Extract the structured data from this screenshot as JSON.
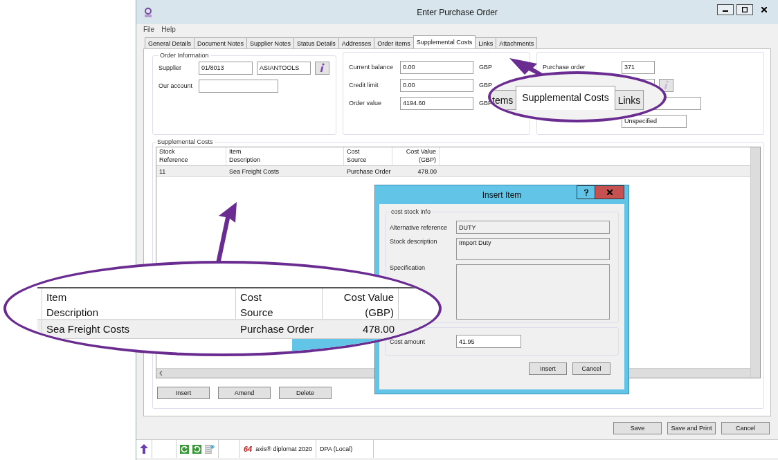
{
  "window": {
    "title": "Enter Purchase Order"
  },
  "menu": [
    "File",
    "Help"
  ],
  "tabs": [
    {
      "label": "General Details",
      "selected": false
    },
    {
      "label": "Document Notes",
      "selected": false
    },
    {
      "label": "Supplier Notes",
      "selected": false
    },
    {
      "label": "Status Details",
      "selected": false
    },
    {
      "label": "Addresses",
      "selected": false
    },
    {
      "label": "Order Items",
      "selected": false
    },
    {
      "label": "Supplemental Costs",
      "selected": true
    },
    {
      "label": "Links",
      "selected": false
    },
    {
      "label": "Attachments",
      "selected": false
    }
  ],
  "order_information": {
    "title": "Order Information",
    "supplier_label": "Supplier",
    "supplier_code": "01/8013",
    "supplier_name": "ASIANTOOLS",
    "account_label": "Our account"
  },
  "balances": [
    {
      "label": "Current balance",
      "value": "0.00",
      "currency": "GBP"
    },
    {
      "label": "Credit limit",
      "value": "0.00",
      "currency": "GBP"
    },
    {
      "label": "Order value",
      "value": "4194.60",
      "currency": "GBP"
    }
  ],
  "order_details": {
    "purchase_order_label": "Purchase order",
    "purchase_order": "371",
    "delivery_value": "Unspecified"
  },
  "supplemental_costs": {
    "title": "Supplemental Costs",
    "columns": [
      "Stock\nReference",
      "Item\nDescription",
      "Cost\nSource",
      "Cost Value\n(GBP)"
    ],
    "rows": [
      [
        "11",
        "Sea Freight Costs",
        "Purchase Order",
        "478.00"
      ]
    ],
    "buttons": [
      "Insert",
      "Amend",
      "Delete"
    ]
  },
  "footer_buttons": [
    "Save",
    "Save and Print",
    "Cancel"
  ],
  "status_bar": {
    "badge": "64",
    "product": "axis® diplomat 2020",
    "connection": "DPA (Local)"
  },
  "dialog": {
    "title": "Insert Item",
    "group": "cost stock info",
    "alt_ref_label": "Alternative reference",
    "alt_ref": "DUTY",
    "desc_label": "Stock description",
    "desc": "Import Duty",
    "spec_label": "Specification",
    "cost_label": "Cost amount",
    "cost": "41.95",
    "buttons": [
      "Insert",
      "Cancel"
    ]
  },
  "callouts": {
    "tabs": [
      {
        "label": "tems",
        "selected": false
      },
      {
        "label": "Supplemental Costs",
        "selected": true
      },
      {
        "label": "Links",
        "selected": false
      }
    ],
    "columns": [
      "Item\nDescription",
      "Cost\nSource",
      "Cost Value\n(GBP)"
    ],
    "row": [
      "Sea Freight Costs",
      "Purchase Order",
      "478.00"
    ]
  }
}
